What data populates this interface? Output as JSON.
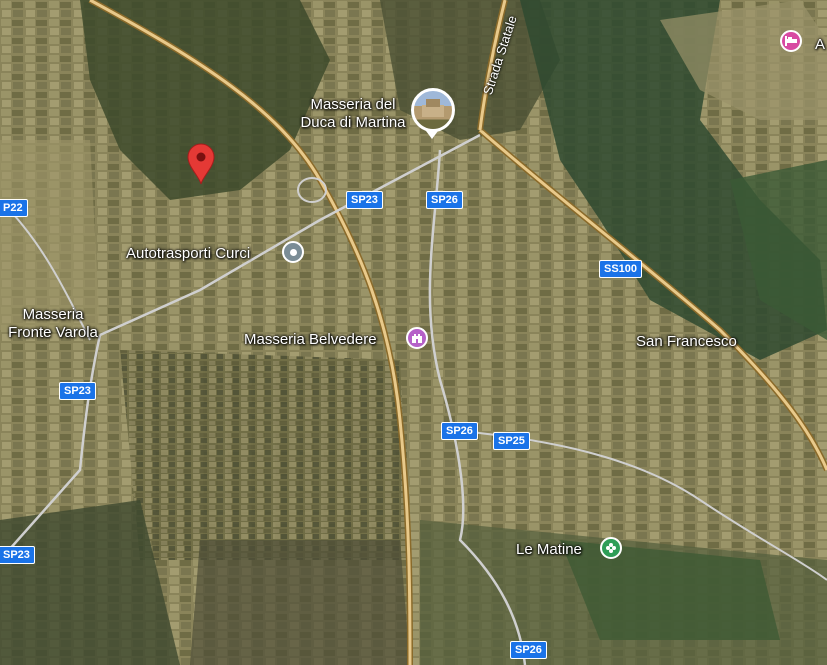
{
  "places": {
    "masseria_duca_line1": "Masseria del",
    "masseria_duca_line2": "Duca di Martina",
    "autotrasporti": "Autotrasporti Curci",
    "fronte_varola_line1": "Masseria",
    "fronte_varola_line2": "Fronte Varola",
    "belvedere": "Masseria Belvedere",
    "san_francesco": "San Francesco",
    "le_matine": "Le Matine",
    "top_right_partial": "A"
  },
  "roads": {
    "strada_statale": "Strada Statale",
    "sp23_a": "SP23",
    "sp23_b": "SP23",
    "sp23_c": "SP23",
    "sp22": "P22",
    "sp26_a": "SP26",
    "sp26_b": "SP26",
    "sp26_c": "SP26",
    "sp25": "SP25",
    "ss100": "SS100"
  },
  "icons": {
    "dropped_pin": "red-location-pin-icon",
    "photo": "masseria-photo-thumbnail",
    "autotrasporti": "gray-place-icon",
    "belvedere": "landmark-castle-icon",
    "le_matine": "green-flower-icon",
    "hotel": "hotel-bed-icon"
  },
  "colors": {
    "pin": "#e53935",
    "landmark": "#b561c8",
    "green": "#2e9e57",
    "shield": "#1a73e8",
    "road": "#e8c98a"
  }
}
